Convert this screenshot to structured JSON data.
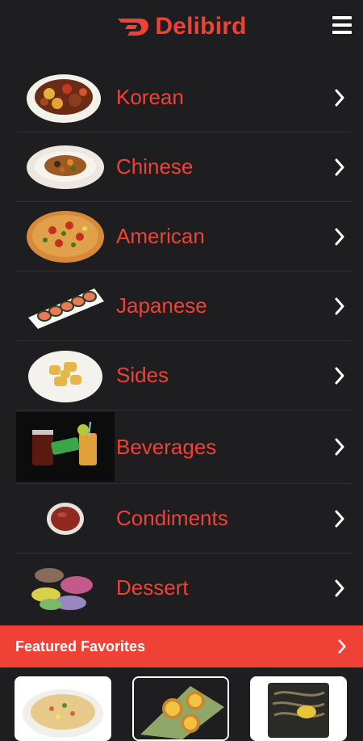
{
  "app": {
    "brand": "Delibird"
  },
  "header": {
    "menu_icon": "hamburger-menu-icon",
    "logo_icon": "delivery-swoosh-icon"
  },
  "categories": [
    {
      "label": "Korean",
      "icon": "korean-dish-icon"
    },
    {
      "label": "Chinese",
      "icon": "chinese-dish-icon"
    },
    {
      "label": "American",
      "icon": "pizza-icon"
    },
    {
      "label": "Japanese",
      "icon": "sushi-icon"
    },
    {
      "label": "Sides",
      "icon": "fries-icon"
    },
    {
      "label": "Beverages",
      "icon": "drinks-icon"
    },
    {
      "label": "Condiments",
      "icon": "sauce-icon"
    },
    {
      "label": "Dessert",
      "icon": "macaron-icon"
    }
  ],
  "featured": {
    "label": "Featured Favorites"
  },
  "featured_items": [
    {
      "icon": "fried-rice-icon"
    },
    {
      "icon": "egg-tart-icon"
    },
    {
      "icon": "japchae-icon"
    }
  ],
  "colors": {
    "accent": "#ef4136",
    "background": "#1e1e20",
    "chevron": "#ffffff"
  }
}
